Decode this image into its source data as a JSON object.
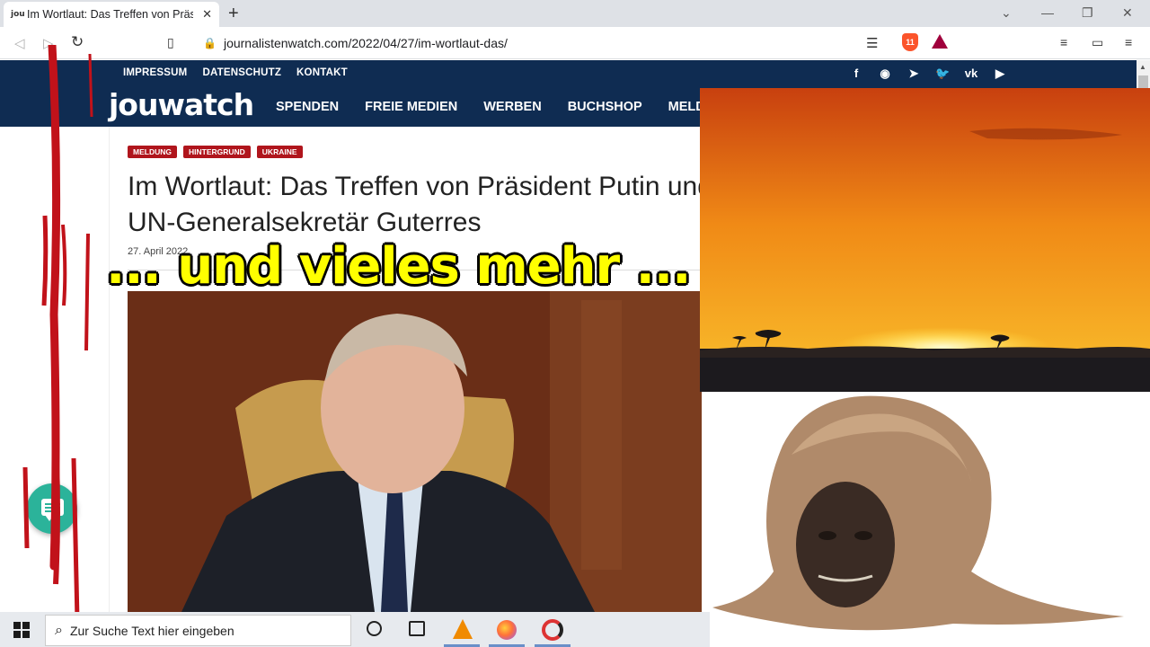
{
  "browser": {
    "favicon": "jou",
    "tab_title": "Im Wortlaut: Das Treffen von Präs",
    "url": "journalistenwatch.com/2022/04/27/im-wortlaut-das/",
    "brave_badge": "11",
    "icons": [
      "back-icon",
      "forward-icon",
      "reload-icon",
      "bookmark-icon",
      "lock-icon",
      "reader-mode-icon",
      "brave-shields-icon",
      "brave-rewards-icon",
      "playlist-icon",
      "wallet-icon",
      "menu-icon"
    ]
  },
  "site": {
    "topnav": [
      "IMPRESSUM",
      "DATENSCHUTZ",
      "KONTAKT"
    ],
    "social_icons": [
      "facebook-icon",
      "rss-icon",
      "telegram-icon",
      "twitter-icon",
      "vk-icon",
      "youtube-icon"
    ],
    "social_glyphs": [
      "f",
      "◉",
      "➤",
      "🐦",
      "vk",
      "▶"
    ],
    "logo": "jouwatch",
    "mainnav": [
      "SPENDEN",
      "FREIE MEDIEN",
      "WERBEN",
      "BUCHSHOP",
      "MELDU"
    ],
    "brand_color": "#0f2c52"
  },
  "article": {
    "tags": [
      "MELDUNG",
      "HINTERGRUND",
      "UKRAINE"
    ],
    "tag_color": "#b0151c",
    "title": "Im Wortlaut: Das Treffen von Präsident Putin und UN-Generalsekretär Guterres",
    "date": "27. April 2022"
  },
  "overlay": {
    "text": "... und vieles mehr ...",
    "color": "#ffff00"
  },
  "taskbar": {
    "search_placeholder": "Zur Suche Text hier eingeben",
    "apps": [
      "cortana-icon",
      "task-view-icon",
      "vlc-icon",
      "firefox-icon",
      "app-icon"
    ]
  }
}
